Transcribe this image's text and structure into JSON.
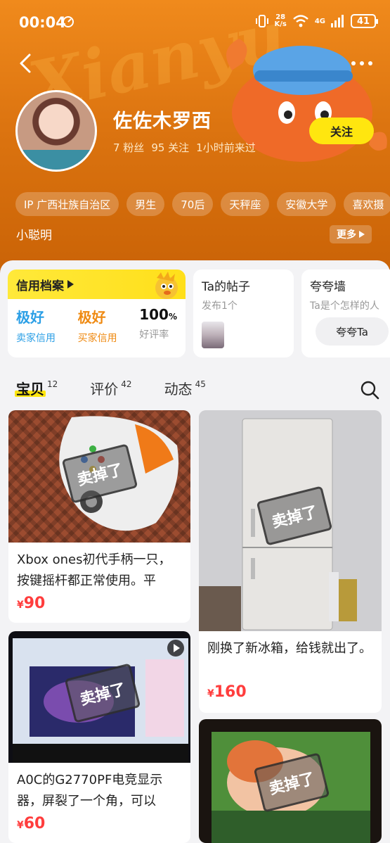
{
  "status_bar": {
    "time": "00:04",
    "net_speed_value": "28",
    "net_speed_unit": "K/s",
    "network": "4G",
    "battery": "41"
  },
  "profile": {
    "name": "佐佐木罗西",
    "stats": [
      "7 粉丝",
      "95 关注",
      "1小时前来过"
    ],
    "follow_label": "关注",
    "tags": [
      "IP 广西壮族自治区",
      "男生",
      "70后",
      "天秤座",
      "安徽大学",
      "喜欢摄"
    ],
    "bio": "小聪明",
    "more_label": "更多"
  },
  "credit": {
    "title": "信用档案",
    "items": [
      {
        "value": "极好",
        "label": "卖家信用"
      },
      {
        "value": "极好",
        "label": "买家信用"
      },
      {
        "value": "100",
        "unit": "%",
        "label": "好评率"
      }
    ]
  },
  "posts": {
    "title": "Ta的帖子",
    "subtitle": "发布1个"
  },
  "praise": {
    "title": "夸夸墙",
    "subtitle": "Ta是个怎样的人",
    "button": "夸夸Ta"
  },
  "tabs": [
    {
      "label": "宝贝",
      "count": "12"
    },
    {
      "label": "评价",
      "count": "42"
    },
    {
      "label": "动态",
      "count": "45"
    }
  ],
  "sold_badge": "卖掉了",
  "items": [
    {
      "title": "Xbox ones初代手柄一只，按键摇杆都正常使用。平",
      "currency": "¥",
      "price": "90"
    },
    {
      "title": "刚换了新冰箱，给钱就出了。",
      "currency": "¥",
      "price": "160"
    },
    {
      "title": "A0C的G2770PF电竞显示器，屏裂了一个角，可以",
      "currency": "¥",
      "price": "60"
    },
    {
      "title": "",
      "currency": "",
      "price": ""
    }
  ],
  "colors": {
    "header": "#e07a14",
    "accent_yellow": "#ffe60f",
    "price_red": "#ff3d3d",
    "credit_blue": "#2b9fe6",
    "credit_orange": "#ef8a12"
  }
}
